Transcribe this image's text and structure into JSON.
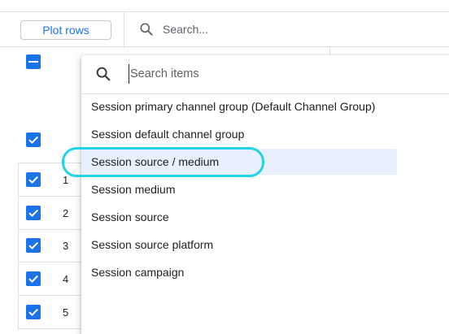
{
  "toolbar": {
    "plot_rows_label": "Plot rows",
    "search_placeholder": "Search..."
  },
  "table": {
    "row_numbers": [
      "1",
      "2",
      "3",
      "4",
      "5"
    ]
  },
  "dropdown": {
    "search_placeholder": "Search items",
    "items": [
      "Session primary channel group (Default Channel Group)",
      "Session default channel group",
      "Session source / medium",
      "Session medium",
      "Session source",
      "Session source platform",
      "Session campaign"
    ],
    "selected_index": 2
  },
  "colors": {
    "accent": "#1a73e8",
    "highlight_ring": "#22d3e6",
    "selected_bg": "#e8f0fe"
  }
}
